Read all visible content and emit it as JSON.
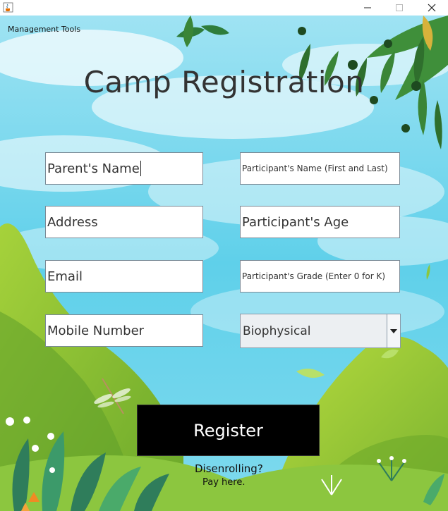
{
  "window": {
    "icon": "java-cup-icon",
    "controls": [
      "minimize",
      "maximize",
      "close"
    ]
  },
  "menu": {
    "label": "Management Tools"
  },
  "title": "Camp Registration",
  "fields": {
    "parent_name": "Parent's Name",
    "participant_name": "Participant's Name (First and Last)",
    "address": "Address",
    "participant_age": "Participant's Age",
    "email": "Email",
    "participant_grade": "Participant's Grade (Enter 0 for K)",
    "mobile": "Mobile Number"
  },
  "select": {
    "value": "Biophysical"
  },
  "register_label": "Register",
  "links": {
    "disenroll": "Disenrolling?",
    "pay": "Pay here."
  },
  "colors": {
    "sky": "#6fd3ec",
    "grass": "#8cc63f",
    "button": "#000000"
  }
}
